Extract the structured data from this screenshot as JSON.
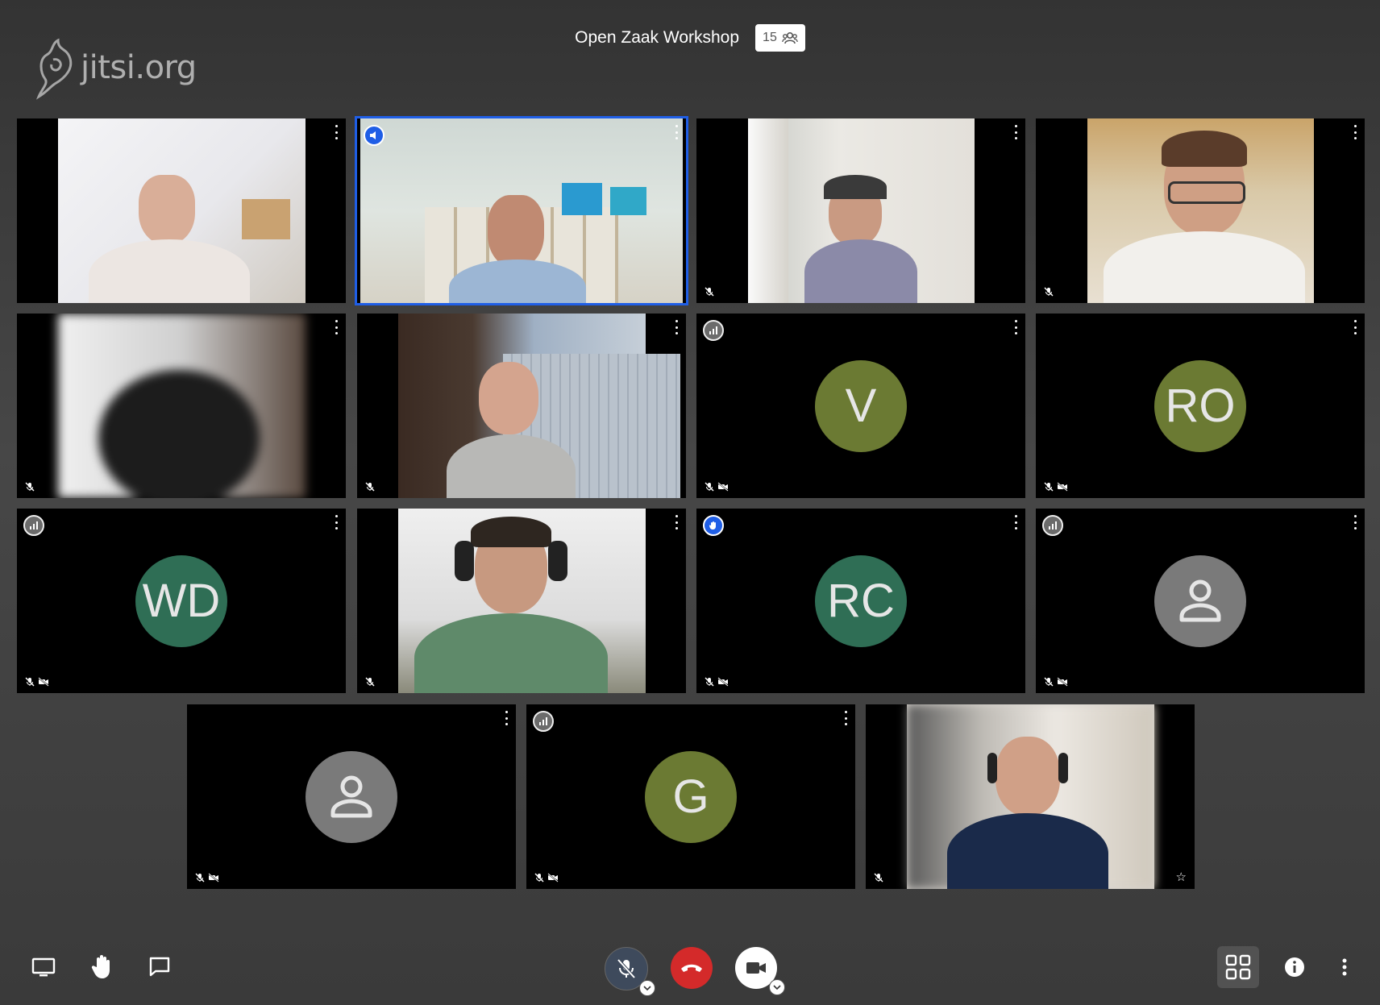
{
  "logo": {
    "text": "jitsi.org",
    "icon": "jitsi-logo-icon"
  },
  "header": {
    "title": "Open Zaak Workshop",
    "participant_count": "15",
    "count_icon": "participants-icon"
  },
  "tiles": [
    {
      "id": "p1",
      "type": "video",
      "muted": false,
      "video_off": false
    },
    {
      "id": "p2",
      "type": "video",
      "active_speaker": true,
      "indicator": "dominant-speaker-icon"
    },
    {
      "id": "p3",
      "type": "video",
      "muted": true
    },
    {
      "id": "p4",
      "type": "video",
      "muted": true
    },
    {
      "id": "p5",
      "type": "video",
      "muted": true,
      "blurred": true
    },
    {
      "id": "p6",
      "type": "video",
      "muted": true
    },
    {
      "id": "p7",
      "type": "avatar",
      "initials": "V",
      "color": "#6b7a33",
      "muted": true,
      "video_off": true,
      "indicator": "connection-status-icon"
    },
    {
      "id": "p8",
      "type": "avatar",
      "initials": "RO",
      "color": "#6b7a33",
      "muted": true,
      "video_off": true
    },
    {
      "id": "p9",
      "type": "avatar",
      "initials": "WD",
      "color": "#2f6e55",
      "muted": true,
      "video_off": true,
      "indicator": "connection-status-icon"
    },
    {
      "id": "p10",
      "type": "video",
      "muted": true
    },
    {
      "id": "p11",
      "type": "avatar",
      "initials": "RC",
      "color": "#2f6e55",
      "muted": true,
      "video_off": true,
      "indicator": "raised-hand-icon"
    },
    {
      "id": "p12",
      "type": "avatar-generic",
      "color": "#7a7a7a",
      "muted": true,
      "video_off": true,
      "indicator": "connection-status-icon"
    },
    {
      "id": "p13",
      "type": "avatar-generic",
      "color": "#7a7a7a",
      "muted": true,
      "video_off": true
    },
    {
      "id": "p14",
      "type": "avatar",
      "initials": "G",
      "color": "#6b7a33",
      "muted": true,
      "video_off": true,
      "indicator": "connection-status-icon"
    },
    {
      "id": "p15",
      "type": "video",
      "muted": true,
      "blurred": true,
      "local": true
    }
  ],
  "toolbar": {
    "left": [
      "screen-share-icon",
      "raise-hand-icon",
      "chat-icon"
    ],
    "center": [
      "microphone-muted-icon",
      "hangup-icon",
      "camera-icon"
    ],
    "right": [
      "tile-view-icon",
      "info-icon",
      "more-options-icon"
    ]
  },
  "colors": {
    "active_border": "#1f5ee6",
    "hangup": "#d42a2a",
    "mic_bg": "#3e4a5c"
  }
}
